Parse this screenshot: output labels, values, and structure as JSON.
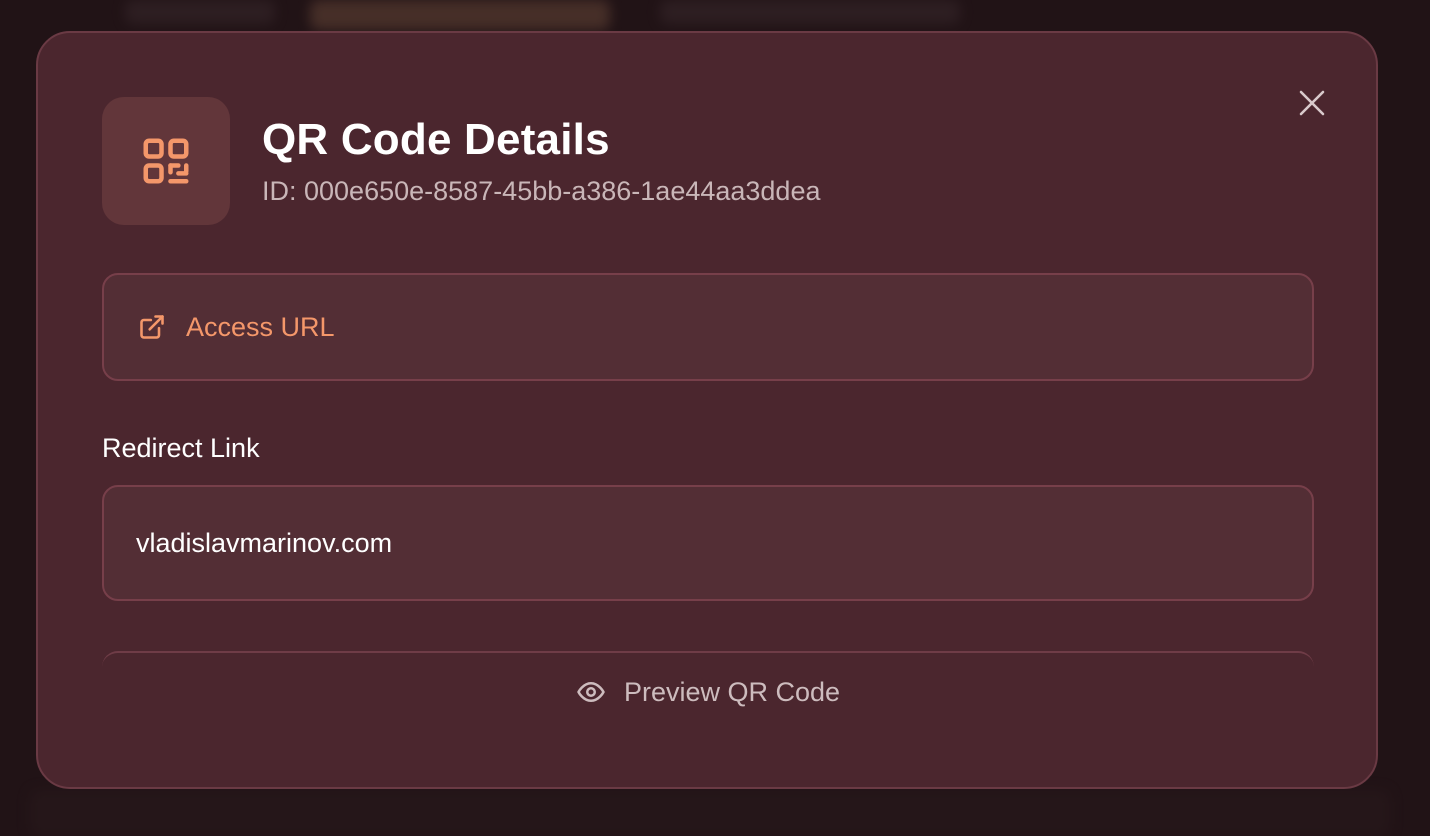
{
  "modal": {
    "title": "QR Code Details",
    "id_text": "ID: 000e650e-8587-45bb-a386-1ae44aa3ddea",
    "access_url_label": "Access URL",
    "redirect_label": "Redirect Link",
    "redirect_value": "vladislavmarinov.com",
    "preview_label": "Preview QR Code"
  },
  "icons": {
    "close": "close-icon",
    "qr": "qr-code-icon",
    "external_link": "external-link-icon",
    "eye": "eye-icon"
  },
  "colors": {
    "modal_bg": "#4b262e",
    "accent": "#f4976a",
    "text_primary": "#ffffff",
    "text_muted": "#c9b6b8"
  }
}
